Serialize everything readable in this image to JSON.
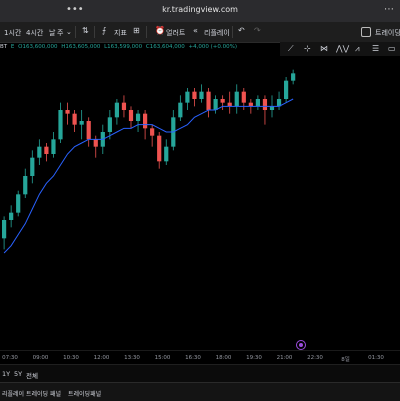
{
  "browser": {
    "url": "kr.tradingview.com",
    "menu_icon": "kebab-icon",
    "dots_icon": "ellipsis-icon"
  },
  "toolbar": {
    "interval_1h": "1시간",
    "interval_4h": "4시간",
    "interval_day": "날",
    "interval_week": "주",
    "indicators_label": "지표",
    "alert_label": "얼러트",
    "replay_label": "리플레이",
    "trade_label": "트레이딩"
  },
  "legend": {
    "symbol": "BT",
    "bar": "E",
    "open": "O163,600,000",
    "high": "H163,605,000",
    "low": "L163,599,000",
    "close": "C163,604,000",
    "change": "+4,000 (+0.00%)"
  },
  "chart_data": {
    "type": "candlestick",
    "up_color": "#26a69a",
    "down_color": "#ef5350",
    "ma_color": "#2962ff",
    "grid": false,
    "x_ticks": [
      "07:30",
      "09:00",
      "10:30",
      "12:00",
      "13:30",
      "15:00",
      "16:30",
      "18:00",
      "19:30",
      "21:00",
      "22:30",
      "8일",
      "01:30"
    ],
    "candles": [
      [
        23,
        28,
        20,
        29
      ],
      [
        28,
        30,
        26,
        32
      ],
      [
        30,
        35,
        29,
        36
      ],
      [
        35,
        40,
        34,
        42
      ],
      [
        40,
        45,
        38,
        47
      ],
      [
        45,
        48,
        43,
        50
      ],
      [
        48,
        46,
        44,
        49
      ],
      [
        46,
        50,
        45,
        52
      ],
      [
        50,
        58,
        49,
        60
      ],
      [
        58,
        57,
        54,
        60
      ],
      [
        57,
        54,
        52,
        58
      ],
      [
        54,
        55,
        50,
        58
      ],
      [
        55,
        50,
        48,
        56
      ],
      [
        50,
        48,
        45,
        51
      ],
      [
        48,
        52,
        46,
        54
      ],
      [
        52,
        56,
        50,
        58
      ],
      [
        56,
        60,
        54,
        61
      ],
      [
        60,
        58,
        56,
        62
      ],
      [
        58,
        55,
        53,
        59
      ],
      [
        55,
        57,
        52,
        58
      ],
      [
        57,
        53,
        50,
        58
      ],
      [
        53,
        51,
        48,
        54
      ],
      [
        51,
        44,
        42,
        52
      ],
      [
        44,
        48,
        43,
        50
      ],
      [
        48,
        56,
        47,
        58
      ],
      [
        56,
        60,
        55,
        62
      ],
      [
        60,
        63,
        58,
        64
      ],
      [
        63,
        61,
        59,
        64
      ],
      [
        61,
        63,
        60,
        65
      ],
      [
        63,
        58,
        56,
        64
      ],
      [
        58,
        61,
        57,
        62
      ],
      [
        61,
        60,
        58,
        62
      ],
      [
        60,
        59,
        57,
        63
      ],
      [
        59,
        63,
        57,
        65
      ],
      [
        63,
        60,
        58,
        64
      ],
      [
        60,
        59,
        57,
        61
      ],
      [
        59,
        61,
        58,
        62
      ],
      [
        61,
        58,
        54,
        62
      ],
      [
        58,
        59,
        56,
        62
      ],
      [
        59,
        61,
        58,
        63
      ],
      [
        61,
        66,
        60,
        67
      ],
      [
        66,
        68,
        65,
        69
      ]
    ],
    "moving_average": [
      19,
      21,
      24,
      27,
      31,
      35,
      38,
      40,
      43,
      46,
      48,
      49,
      50,
      50,
      50,
      51,
      52,
      53,
      53,
      54,
      54,
      54,
      53,
      52,
      52,
      53,
      54,
      56,
      57,
      58,
      58,
      59,
      59,
      59,
      59,
      59,
      59,
      59,
      59,
      59,
      60,
      61
    ],
    "y_range": [
      10,
      70
    ]
  },
  "timeframes": [
    "1Y",
    "5Y",
    "전체"
  ],
  "bottom_tabs": [
    "리플레이 트레이딩 패널",
    "트레이딩패널"
  ]
}
